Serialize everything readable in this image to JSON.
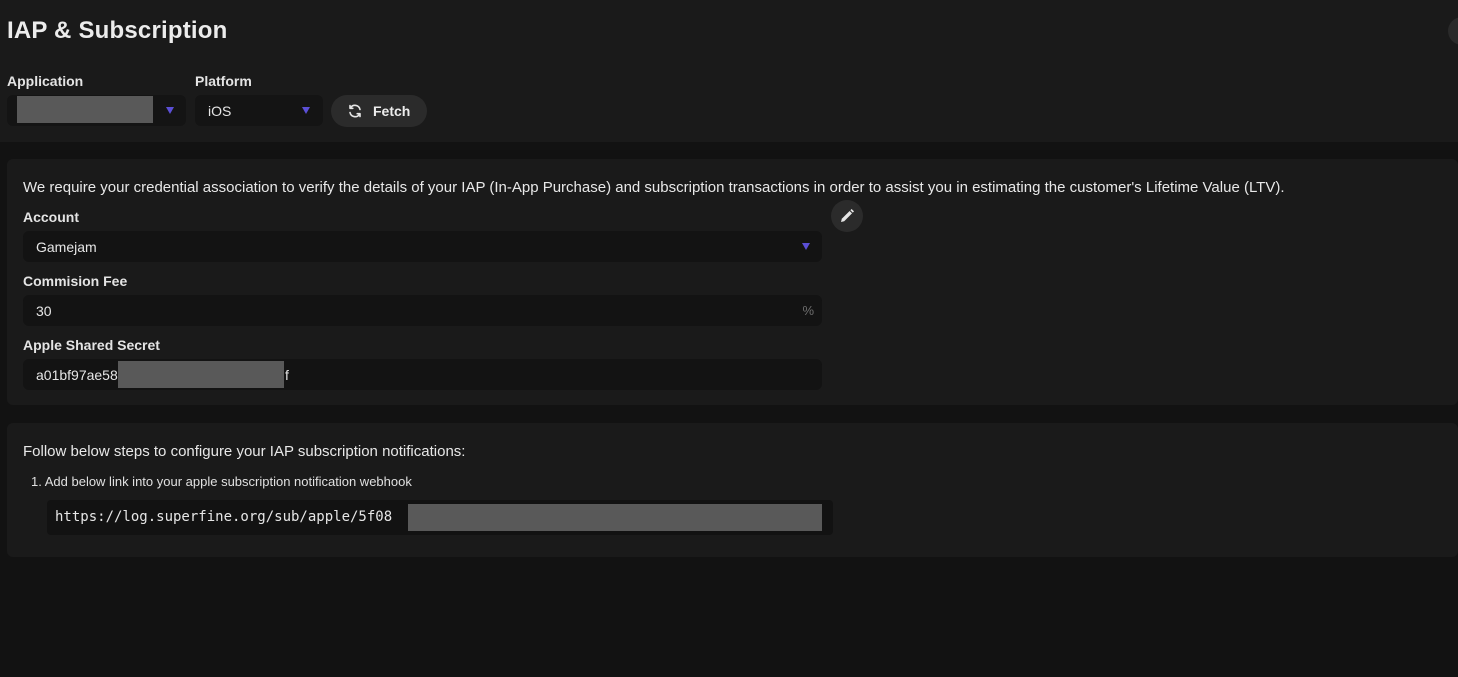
{
  "page": {
    "title": "IAP & Subscription"
  },
  "filters": {
    "application_label": "Application",
    "platform_label": "Platform",
    "platform_value": "iOS",
    "fetch_label": "Fetch"
  },
  "credentials": {
    "description": "We require your credential association to verify the details of your IAP (In-App Purchase) and subscription transactions in order to assist you in estimating the customer's Lifetime Value (LTV).",
    "account_label": "Account",
    "account_value": "Gamejam",
    "commission_label": "Commision Fee",
    "commission_value": "30",
    "commission_suffix": "%",
    "secret_label": "Apple Shared Secret",
    "secret_prefix": "a01bf97ae58",
    "secret_suffix": "f"
  },
  "notifications": {
    "title": "Follow below steps to configure your IAP subscription notifications:",
    "step1": "1. Add below link into your apple subscription notification webhook",
    "webhook_url_visible": "https://log.superfine.org/sub/apple/5f08"
  },
  "colors": {
    "accent_caret": "#5b4fd6",
    "redaction": "#595959"
  },
  "icons": {
    "fetch": "refresh-icon",
    "edit": "pencil-icon",
    "caret": "chevron-down-icon"
  }
}
